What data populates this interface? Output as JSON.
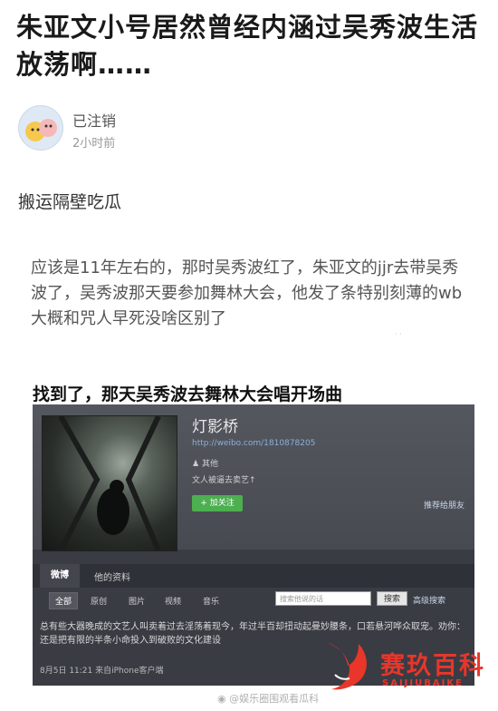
{
  "post": {
    "title": "朱亚文小号居然曾经内涵过吴秀波生活放荡啊……",
    "author": "已注销",
    "time": "2小时前",
    "lead": "搬运隔壁吃瓜",
    "quote": "应该是11年左右的，那时吴秀波红了，朱亚文的jjr去带吴秀波了，吴秀波那天要参加舞林大会，他发了条特别刻薄的wb大概和咒人早死没啥区别了",
    "found": "找到了，那天吴秀波去舞林大会唱开场曲"
  },
  "screenshot": {
    "profile_name": "灯影桥",
    "profile_url": "http://weibo.com/1810878205",
    "profile_meta": "其他",
    "profile_bio": "文人被逼去卖艺↑",
    "follow_label": "+ 加关注",
    "recommend_label": "推荐给朋友",
    "tabs": [
      "微博",
      "他的资料"
    ],
    "filters": [
      "全部",
      "原创",
      "图片",
      "视频",
      "音乐"
    ],
    "search_placeholder": "搜索他说的话",
    "search_button": "搜索",
    "advanced_search": "高级搜索",
    "post_text": "总有些大器晚成的文艺人叫卖着过去淫荡着现今，年过半百却扭动起曼妙腰条，口若悬河哗众取宠。劝你：还是把有限的半条小命投入到破败的文化建设",
    "post_meta": "8月5日  11:21    来自iPhone客户端"
  },
  "watermark": {
    "weibo_text": "@娱乐圈围观看瓜科",
    "brand_cn": "赛玖百科",
    "brand_en": "SAIJIUBAIKE"
  },
  "colors": {
    "brand_red": "#e8362a",
    "follow_green": "#4caf50"
  }
}
